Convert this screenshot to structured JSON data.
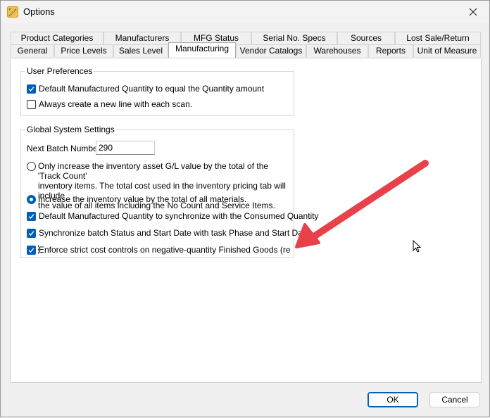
{
  "window": {
    "title": "Options",
    "app_icon": "pencil-ruler-icon",
    "close_icon": "close-icon"
  },
  "tabs": {
    "row1": [
      "Product Categories",
      "Manufacturers",
      "MFG Status",
      "Serial No. Specs",
      "Sources",
      "Lost Sale/Return"
    ],
    "row2": [
      "General",
      "Price Levels",
      "Sales Level",
      "Manufacturing",
      "Vendor Catalogs",
      "Warehouses",
      "Reports",
      "Unit of Measure"
    ],
    "active": "Manufacturing"
  },
  "user_preferences": {
    "title": "User Preferences",
    "default_qty": {
      "label": "Default Manufactured Quantity to equal the Quantity amount",
      "checked": true
    },
    "new_line": {
      "label": "Always create a new line with each scan.",
      "checked": false
    }
  },
  "global_settings": {
    "title": "Global System Settings",
    "next_batch_label": "Next Batch Number:",
    "next_batch_value": "290",
    "option_track_count": {
      "line1": "Only increase the inventory asset G/L value by the total of the 'Track Count'",
      "line2": "inventory items. The total cost used in the inventory pricing tab will include",
      "line3": "the value of all items including the No Count and Service Items.",
      "selected": false
    },
    "option_all_materials": {
      "label": "Increase the inventory value by the total of all materials.",
      "selected": true
    },
    "sync_consumed": {
      "label": "Default Manufactured Quantity to synchronize with the Consumed Quantity",
      "checked": true
    },
    "sync_batch": {
      "label": "Synchronize batch Status and Start Date with task Phase and Start Date",
      "checked": true
    },
    "strict_cost": {
      "label": "Enforce strict cost controls on negative-quantity Finished Goods (recommend",
      "checked": true
    }
  },
  "buttons": {
    "ok": "OK",
    "cancel": "Cancel"
  },
  "annotation": {
    "arrow_color": "#e8414a"
  },
  "colors": {
    "accent": "#005fb8"
  }
}
